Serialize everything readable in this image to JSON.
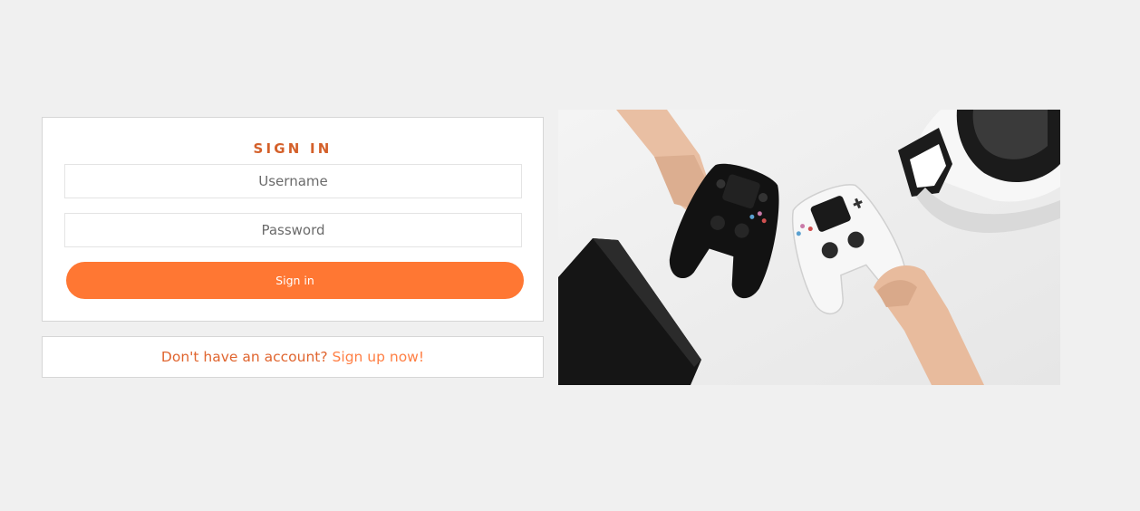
{
  "signin": {
    "title": "SIGN IN",
    "username_placeholder": "Username",
    "password_placeholder": "Password",
    "button_label": "Sign in"
  },
  "signup": {
    "prompt": "Don't have an account?",
    "link_label": "Sign up now!"
  },
  "hero": {
    "alt": "Hands holding game controllers next to a console and VR headset"
  },
  "colors": {
    "accent": "#ff7733",
    "title": "#d4602a",
    "background": "#f0f0f0"
  }
}
